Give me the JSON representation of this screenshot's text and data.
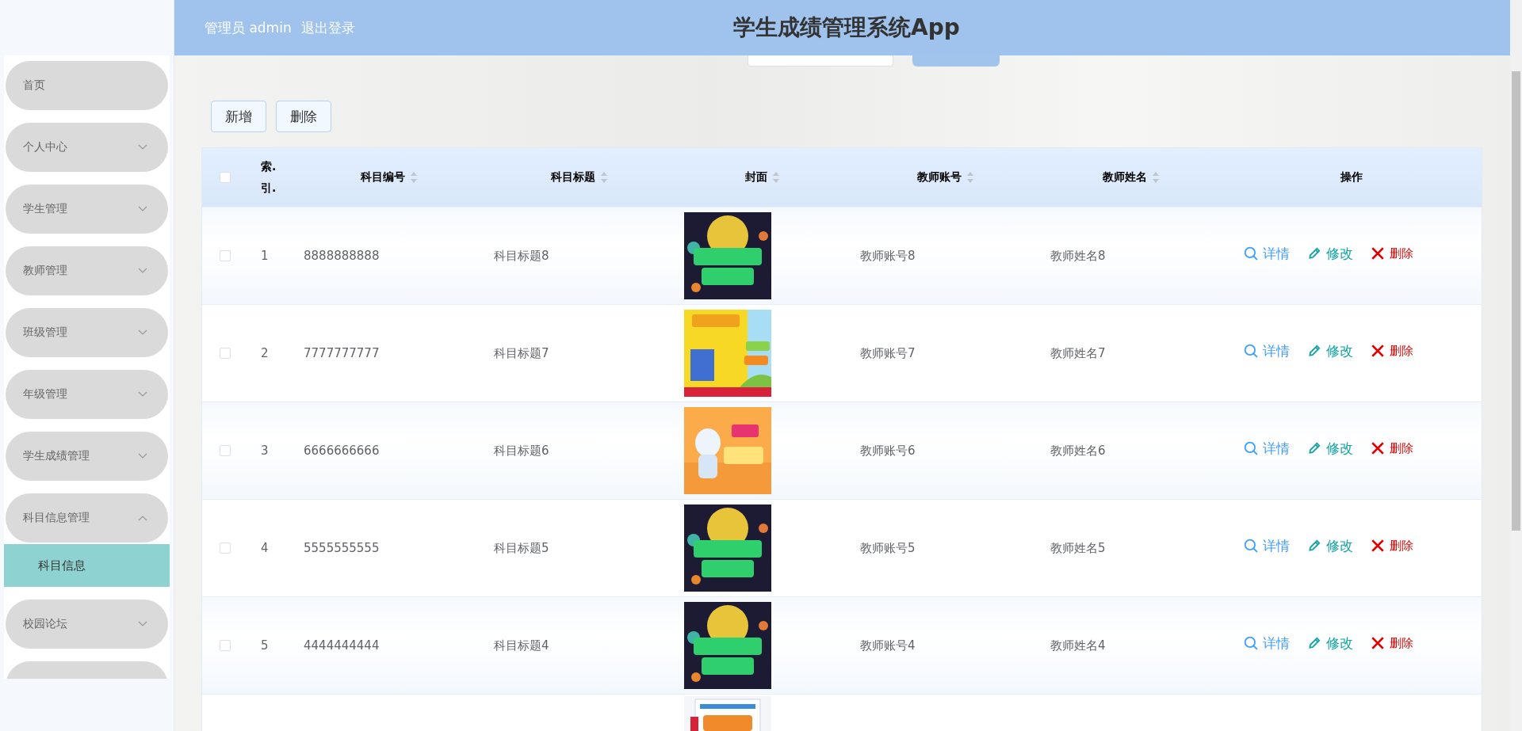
{
  "header": {
    "user": "管理员 admin",
    "logout": "退出登录",
    "title": "学生成绩管理系统App"
  },
  "sidebar": {
    "items": [
      {
        "label": "首页"
      },
      {
        "label": "个人中心",
        "expanded": false
      },
      {
        "label": "学生管理",
        "expanded": false
      },
      {
        "label": "教师管理",
        "expanded": false
      },
      {
        "label": "班级管理",
        "expanded": false
      },
      {
        "label": "年级管理",
        "expanded": false
      },
      {
        "label": "学生成绩管理",
        "expanded": false
      },
      {
        "label": "科目信息管理",
        "expanded": true,
        "children": [
          {
            "label": "科目信息",
            "selected": true
          }
        ]
      },
      {
        "label": "校园论坛",
        "expanded": false
      }
    ]
  },
  "toolbar": {
    "buttons": [
      "新增",
      "删除"
    ]
  },
  "table": {
    "all_checked": false,
    "columns": [
      {
        "label": "索.引.",
        "sortable": false
      },
      {
        "label": "科目编号",
        "sortable": true
      },
      {
        "label": "科目标题",
        "sortable": true
      },
      {
        "label": "封面",
        "sortable": true
      },
      {
        "label": "教师账号",
        "sortable": true
      },
      {
        "label": "教师姓名",
        "sortable": true
      },
      {
        "label": "操作",
        "sortable": false
      }
    ],
    "rows": [
      {
        "index": "1",
        "code": "8888888888",
        "title": "科目标题8",
        "account": "教师账号8",
        "name": "教师姓名8",
        "checked": false,
        "actions": [
          {
            "kind": "view",
            "label": "详情"
          },
          {
            "kind": "edit",
            "label": "修改"
          },
          {
            "kind": "delete",
            "label": "删除"
          }
        ]
      },
      {
        "index": "2",
        "code": "7777777777",
        "title": "科目标题7",
        "account": "教师账号7",
        "name": "教师姓名7",
        "checked": false,
        "actions": [
          {
            "kind": "view",
            "label": "详情"
          },
          {
            "kind": "edit",
            "label": "修改"
          },
          {
            "kind": "delete",
            "label": "删除"
          }
        ]
      },
      {
        "index": "3",
        "code": "6666666666",
        "title": "科目标题6",
        "account": "教师账号6",
        "name": "教师姓名6",
        "checked": false,
        "actions": [
          {
            "kind": "view",
            "label": "详情"
          },
          {
            "kind": "edit",
            "label": "修改"
          },
          {
            "kind": "delete",
            "label": "删除"
          }
        ]
      },
      {
        "index": "4",
        "code": "5555555555",
        "title": "科目标题5",
        "account": "教师账号5",
        "name": "教师姓名5",
        "checked": false,
        "actions": [
          {
            "kind": "view",
            "label": "详情"
          },
          {
            "kind": "edit",
            "label": "修改"
          },
          {
            "kind": "delete",
            "label": "删除"
          }
        ]
      },
      {
        "index": "5",
        "code": "4444444444",
        "title": "科目标题4",
        "account": "教师账号4",
        "name": "教师姓名4",
        "checked": false,
        "actions": [
          {
            "kind": "view",
            "label": "详情"
          },
          {
            "kind": "edit",
            "label": "修改"
          },
          {
            "kind": "delete",
            "label": "删除"
          }
        ]
      }
    ]
  }
}
